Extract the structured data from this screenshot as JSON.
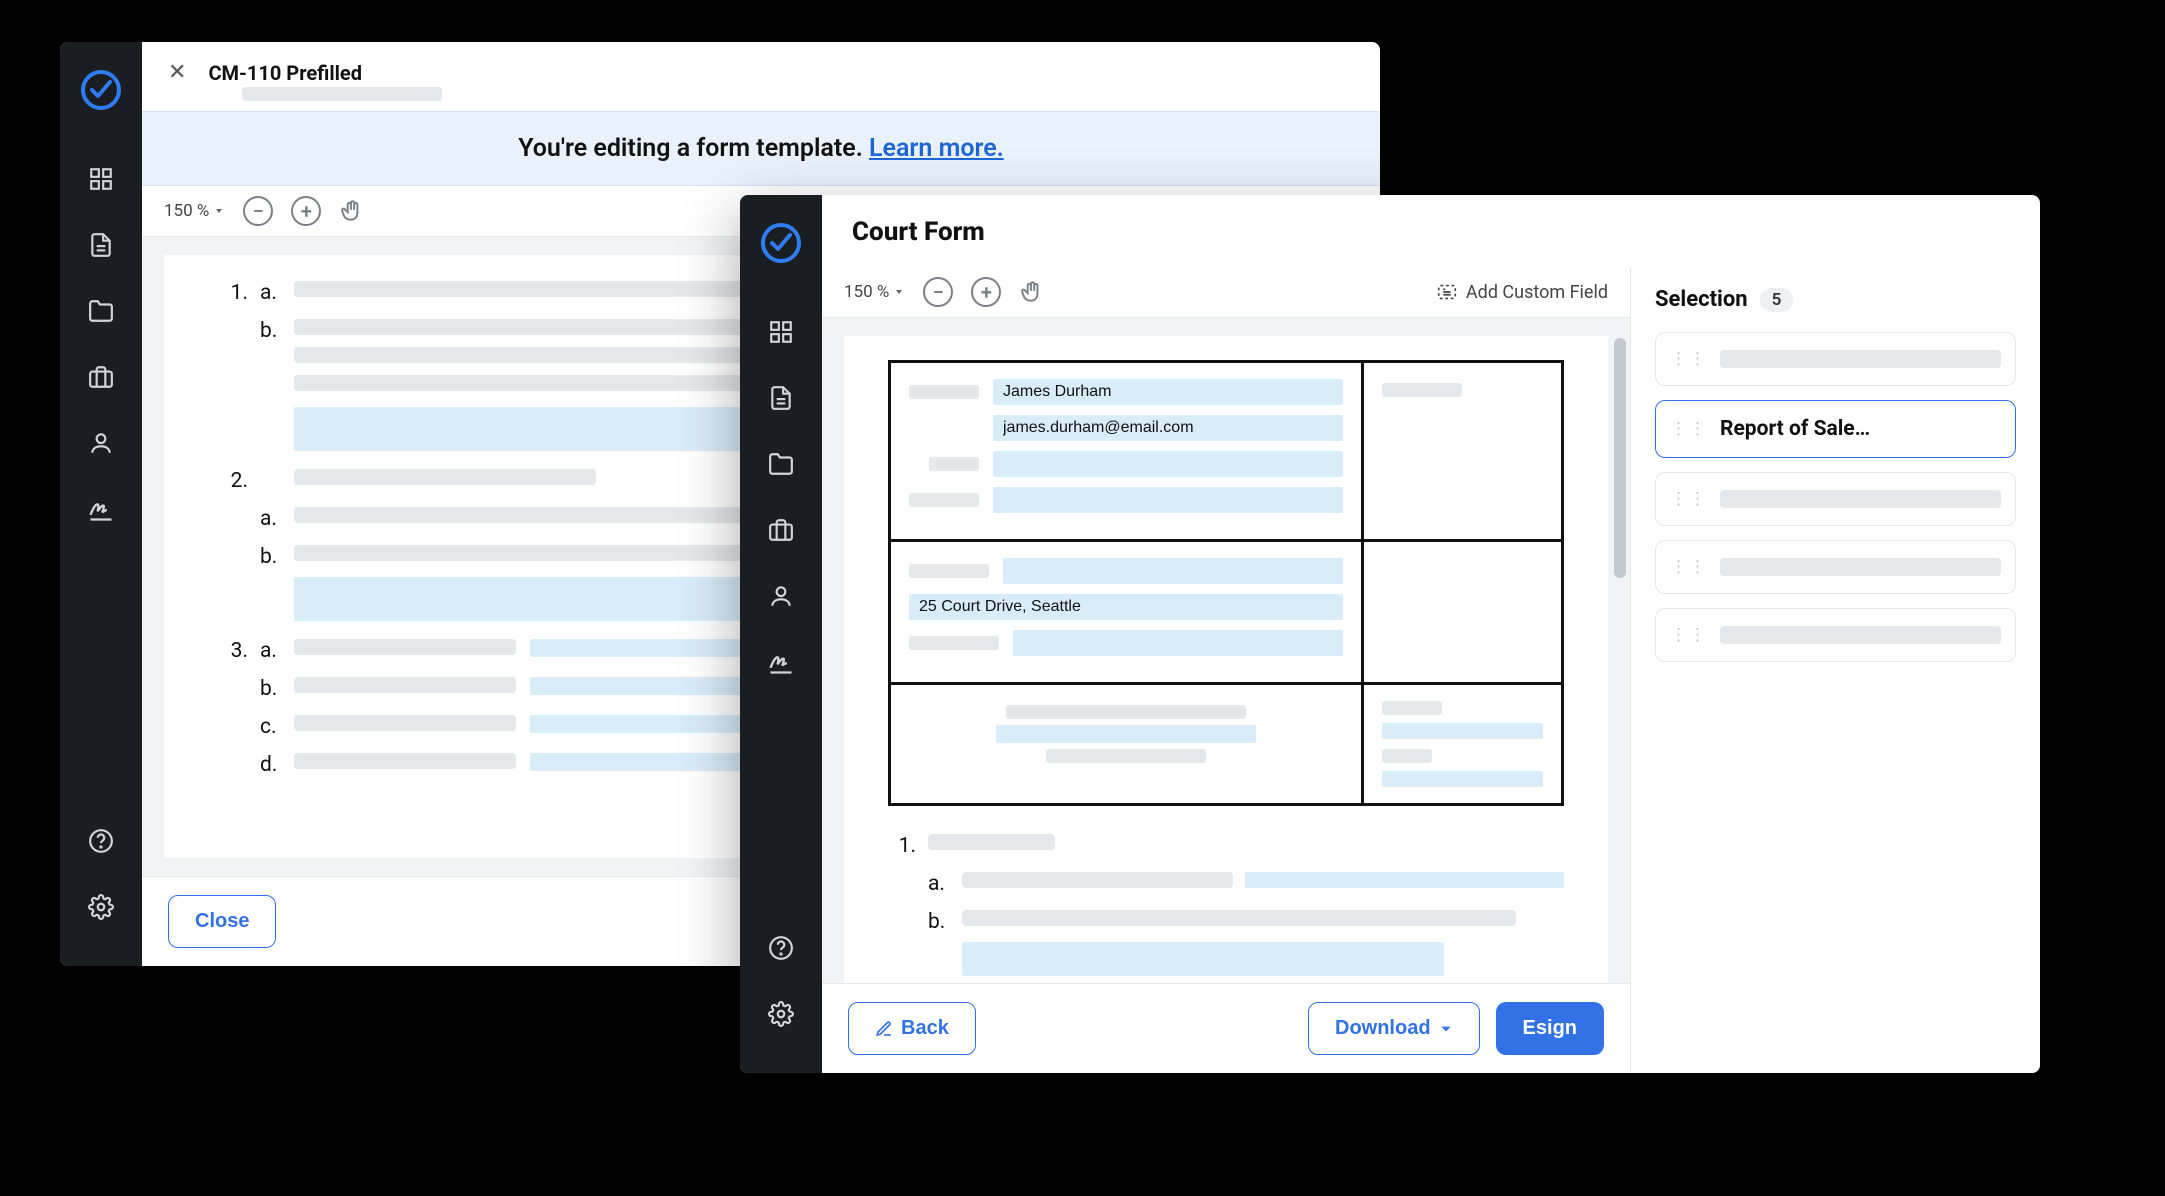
{
  "back": {
    "title": "CM-110 Prefilled",
    "banner_text": "You're editing a form template. ",
    "banner_link": "Learn more.",
    "zoom": "150 %",
    "close_btn": "Close",
    "list": {
      "item1": {
        "num": "1.",
        "a": "a.",
        "b": "b."
      },
      "item2": {
        "num": "2.",
        "a": "a.",
        "b": "b."
      },
      "item3": {
        "num": "3.",
        "a": "a.",
        "b": "b.",
        "c": "c.",
        "d": "d."
      }
    }
  },
  "front": {
    "title": "Court Form",
    "zoom": "150 %",
    "add_custom": "Add Custom Field",
    "back_btn": "Back",
    "download_btn": "Download",
    "esign_btn": "Esign",
    "selection_title": "Selection",
    "selection_count": "5",
    "selection_items": {
      "active_label": "Report of Sale…"
    },
    "form": {
      "name": "James Durham",
      "email": "james.durham@email.com",
      "address": "25 Court Drive, Seattle"
    },
    "list": {
      "num1": "1.",
      "a": "a.",
      "b": "b."
    }
  }
}
